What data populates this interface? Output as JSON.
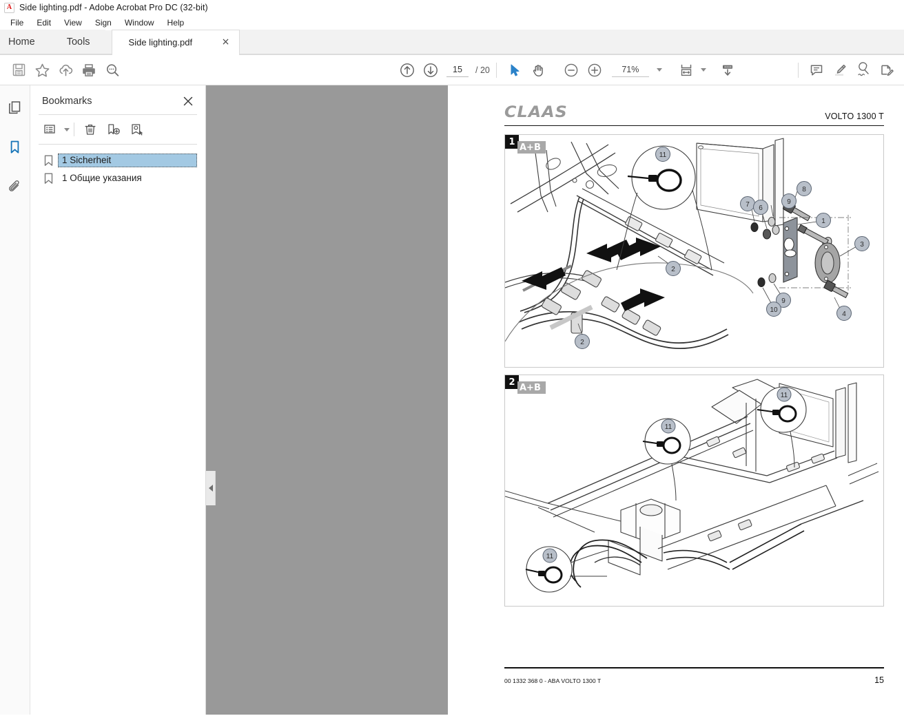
{
  "window": {
    "title": "Side lighting.pdf - Adobe Acrobat Pro DC (32-bit)",
    "app_icon": "acrobat-icon"
  },
  "menubar": {
    "items": [
      {
        "label": "File"
      },
      {
        "label": "Edit"
      },
      {
        "label": "View"
      },
      {
        "label": "Sign"
      },
      {
        "label": "Window"
      },
      {
        "label": "Help"
      }
    ]
  },
  "tabstrip": {
    "home_label": "Home",
    "tools_label": "Tools",
    "document_tab": "Side lighting.pdf",
    "close_glyph": "×"
  },
  "toolbar": {
    "left_icons": [
      {
        "name": "save-icon",
        "tooltip": "Save"
      },
      {
        "name": "star-icon",
        "tooltip": "Add to favorites"
      },
      {
        "name": "cloud-upload-icon",
        "tooltip": "Upload"
      },
      {
        "name": "print-icon",
        "tooltip": "Print"
      },
      {
        "name": "search-icon",
        "tooltip": "Find"
      }
    ],
    "prev_page": "previous-page-icon",
    "next_page": "next-page-icon",
    "page_value": "15",
    "page_total": "/ 20",
    "select_tool": "select-cursor-icon",
    "hand_tool": "hand-icon",
    "zoom_out": "zoom-out-icon",
    "zoom_in": "zoom-in-icon",
    "zoom_value": "71%",
    "fit_page_icon": "fit-page-icon",
    "scroll_mode_icon": "page-scroll-icon",
    "right_icons": [
      {
        "name": "comment-icon",
        "tooltip": "Add comment"
      },
      {
        "name": "highlight-icon",
        "tooltip": "Highlight text"
      },
      {
        "name": "sign-icon",
        "tooltip": "Sign"
      },
      {
        "name": "fill-and-sign-icon",
        "tooltip": "Fill & Sign"
      }
    ]
  },
  "rail": {
    "items": [
      {
        "name": "page-thumbnails-icon",
        "active": false
      },
      {
        "name": "bookmarks-icon",
        "active": true
      },
      {
        "name": "attachments-icon",
        "active": false
      }
    ]
  },
  "panel": {
    "title": "Bookmarks",
    "close_glyph": "✕",
    "tools": [
      {
        "name": "bookmark-options-icon"
      },
      {
        "name": "delete-bookmark-icon"
      },
      {
        "name": "new-bookmark-icon"
      },
      {
        "name": "bookmark-target-icon"
      }
    ],
    "bookmarks": [
      {
        "label": "1 Sicherheit",
        "selected": true
      },
      {
        "label": "1 Общие указания",
        "selected": false
      }
    ]
  },
  "document": {
    "brand": "CLAAS",
    "model": "VOLTO 1300 T",
    "figures": [
      {
        "number": "1",
        "variant": "A+B",
        "callouts": [
          "11",
          "7",
          "6",
          "9",
          "8",
          "1",
          "3",
          "2",
          "9",
          "10",
          "4",
          "2"
        ]
      },
      {
        "number": "2",
        "variant": "A+B",
        "callouts": [
          "11",
          "11",
          "11"
        ]
      }
    ],
    "footer_left": "00 1332 368 0 - ABA VOLTO 1300 T",
    "footer_right": "15"
  },
  "colors": {
    "accent": "#1473b7",
    "selection": "#a3c9e3",
    "gutter": "#999999",
    "chrome": "#f2f2f2"
  }
}
